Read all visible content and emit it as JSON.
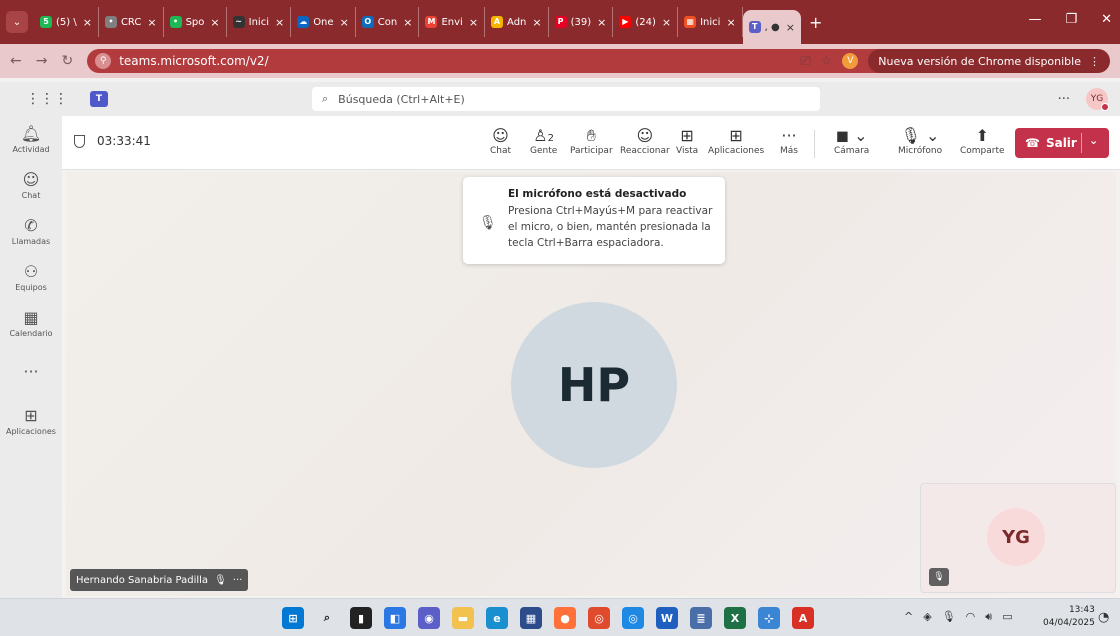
{
  "browser": {
    "tabs": [
      {
        "icon": "spotify-icon",
        "fav": "5",
        "color": "#1db954",
        "label": "(5) \\"
      },
      {
        "icon": "globe-icon",
        "fav": "•",
        "color": "#7f7f7f",
        "label": "CRC"
      },
      {
        "icon": "spotify-icon",
        "fav": "•",
        "color": "#1db954",
        "label": "Spo"
      },
      {
        "icon": "bird-icon",
        "fav": "~",
        "color": "#333333",
        "label": "Inici"
      },
      {
        "icon": "onedrive-icon",
        "fav": "☁",
        "color": "#0a66c2",
        "label": "One"
      },
      {
        "icon": "outlook-icon",
        "fav": "O",
        "color": "#0f6cbd",
        "label": "Con"
      },
      {
        "icon": "gmail-icon",
        "fav": "M",
        "color": "#ea4335",
        "label": "Envi"
      },
      {
        "icon": "admin-icon",
        "fav": "A",
        "color": "#f4b400",
        "label": "Adn"
      },
      {
        "icon": "pinterest-icon",
        "fav": "P",
        "color": "#e60023",
        "label": "(39)"
      },
      {
        "icon": "youtube-icon",
        "fav": "▶",
        "color": "#ff0000",
        "label": "(24)"
      },
      {
        "icon": "microsoft-icon",
        "fav": "▦",
        "color": "#f25022",
        "label": "Inici"
      }
    ],
    "active_tab_label": ", ●",
    "address": "teams.microsoft.com/v2/",
    "profile_initial": "V",
    "update_label": "Nueva versión de Chrome disponible"
  },
  "teams": {
    "search_placeholder": "Búsqueda (Ctrl+Alt+E)",
    "more_label": "···",
    "user_initials": "YG",
    "rail": [
      {
        "icon": "bell-icon",
        "glyph": "🔔︎",
        "label": "Actividad"
      },
      {
        "icon": "chat-icon",
        "glyph": "☺",
        "label": "Chat"
      },
      {
        "icon": "phone-icon",
        "glyph": "✆",
        "label": "Llamadas"
      },
      {
        "icon": "teams-icon",
        "glyph": "⚇",
        "label": "Equipos"
      },
      {
        "icon": "calendar-icon",
        "glyph": "▦",
        "label": "Calendario"
      },
      {
        "icon": "more-icon",
        "glyph": "···",
        "label": ""
      },
      {
        "icon": "apps-icon",
        "glyph": "⊞",
        "label": "Aplicaciones"
      }
    ]
  },
  "meeting": {
    "timer": "03:33:41",
    "people_count": "2",
    "tools": {
      "chat": "Chat",
      "people": "Gente",
      "raise": "Participar",
      "react": "Reaccionar",
      "view": "Vista",
      "apps": "Aplicaciones",
      "more": "Más",
      "camera": "Cámara",
      "mic": "Micrófono",
      "share": "Comparte"
    },
    "leave_label": "Salir",
    "notice": {
      "title": "El micrófono está desactivado",
      "body": "Presiona Ctrl+Mayús+M para reactivar el micro, o bien, mantén presionada la tecla Ctrl+Barra espaciadora."
    },
    "participant_initials": "HP",
    "participant_name": "Hernando Sanabria Padilla",
    "self_initials": "YG"
  },
  "taskbar": {
    "time": "13:43",
    "date": "04/04/2025"
  }
}
